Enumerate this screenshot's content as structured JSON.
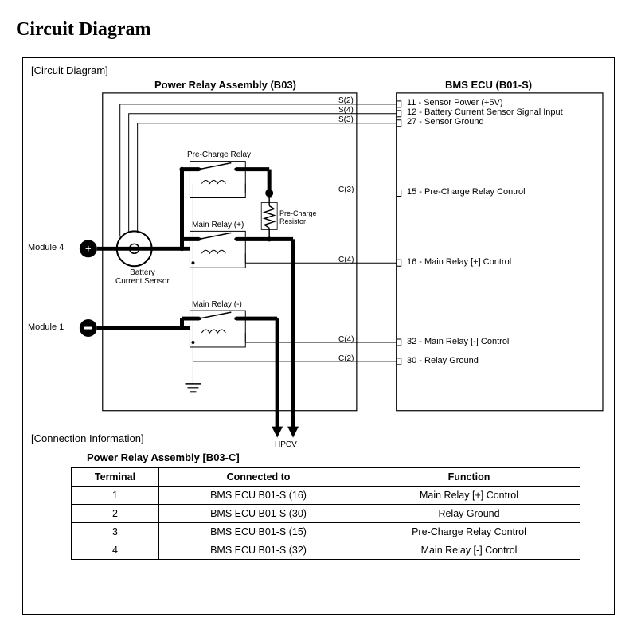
{
  "title": "Circuit Diagram",
  "section_diagram": "[Circuit Diagram]",
  "section_conn": "[Connection Information]",
  "blocks": {
    "pra": "Power Relay Assembly (B03)",
    "bms": "BMS ECU (B01-S)"
  },
  "modules": {
    "m4": "Module 4",
    "m1": "Module 1"
  },
  "components": {
    "pre_charge_relay": "Pre-Charge Relay",
    "main_relay_plus": "Main Relay (+)",
    "main_relay_minus": "Main Relay (-)",
    "battery_current_sensor": "Battery\nCurrent Sensor",
    "pre_charge_resistor": "Pre-Charge\nResistor",
    "hpcv": "HPCV"
  },
  "wires": {
    "s2": "S(2)",
    "s4": "S(4)",
    "s3": "S(3)",
    "c3": "C(3)",
    "c4a": "C(4)",
    "c4b": "C(4)",
    "c2": "C(2)"
  },
  "pins": {
    "p11": "11 - Sensor Power (+5V)",
    "p12": "12 - Battery Current Sensor Signal Input",
    "p27": "27 - Sensor Ground",
    "p15": "15 - Pre-Charge Relay Control",
    "p16": "16 - Main Relay [+] Control",
    "p32": "32 - Main Relay [-] Control",
    "p30": "30 - Relay Ground"
  },
  "conn_table": {
    "title": "Power Relay Assembly [B03-C]",
    "headers": {
      "terminal": "Terminal",
      "connected": "Connected to",
      "function": "Function"
    },
    "rows": [
      {
        "terminal": "1",
        "connected": "BMS ECU B01-S (16)",
        "function": "Main Relay [+] Control"
      },
      {
        "terminal": "2",
        "connected": "BMS ECU B01-S (30)",
        "function": "Relay Ground"
      },
      {
        "terminal": "3",
        "connected": "BMS ECU B01-S (15)",
        "function": "Pre-Charge Relay Control"
      },
      {
        "terminal": "4",
        "connected": "BMS ECU B01-S (32)",
        "function": "Main Relay [-] Control"
      }
    ]
  }
}
